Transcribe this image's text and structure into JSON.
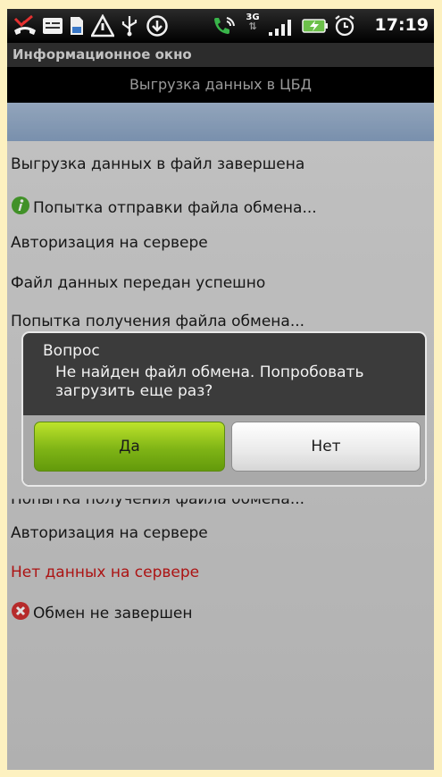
{
  "status_bar": {
    "network_badge": "3G",
    "time": "17:19",
    "icons": [
      "missed-call-icon",
      "message-icon",
      "sd-card-icon",
      "warning-icon",
      "usb-icon",
      "download-icon",
      "wifi-call-icon",
      "network-3g-icon",
      "signal-icon",
      "battery-charging-icon",
      "alarm-icon"
    ]
  },
  "window": {
    "title": "Информационное окно",
    "screen_title": "Выгрузка данных в ЦБД"
  },
  "log": [
    {
      "text": "Выгрузка данных в файл завершена",
      "color": "normal"
    },
    {
      "text": "Попытка отправки файла обмена...",
      "color": "normal",
      "icon": "info-icon"
    },
    {
      "text": "Авторизация на сервере",
      "color": "normal"
    },
    {
      "text": "Файл данных передан успешно",
      "color": "normal"
    },
    {
      "text": "Попытка получения файла обмена...",
      "color": "normal"
    },
    {
      "text": "Попытка получения файла обмена...",
      "color": "normal"
    },
    {
      "text": "Авторизация на сервере",
      "color": "normal"
    },
    {
      "text": "Нет данных на сервере",
      "color": "red"
    },
    {
      "text": "Обмен не завершен",
      "color": "normal",
      "icon": "error-icon"
    }
  ],
  "dialog": {
    "title": "Вопрос",
    "message": "Не найден файл обмена. Попробовать загрузить еще раз?",
    "yes_label": "Да",
    "no_label": "Нет"
  },
  "colors": {
    "accent_green": "#7fb416",
    "error_red": "#c41616",
    "header_blue": "#8aa4c5"
  }
}
